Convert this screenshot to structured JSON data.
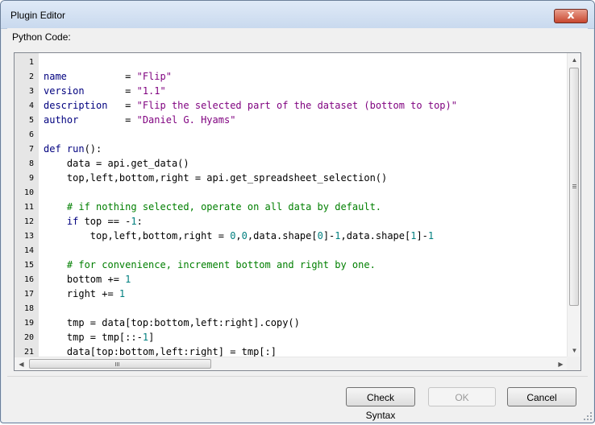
{
  "window": {
    "title": "Plugin Editor",
    "close_glyph": "x"
  },
  "editor": {
    "label": "Python Code:",
    "lines": [
      {
        "n": "1",
        "tokens": []
      },
      {
        "n": "2",
        "tokens": [
          {
            "t": "kw",
            "v": "name"
          },
          {
            "t": "op",
            "v": "          = "
          },
          {
            "t": "str",
            "v": "\"Flip\""
          }
        ]
      },
      {
        "n": "3",
        "tokens": [
          {
            "t": "kw",
            "v": "version"
          },
          {
            "t": "op",
            "v": "       = "
          },
          {
            "t": "str",
            "v": "\"1.1\""
          }
        ]
      },
      {
        "n": "4",
        "tokens": [
          {
            "t": "kw",
            "v": "description"
          },
          {
            "t": "op",
            "v": "   = "
          },
          {
            "t": "str",
            "v": "\"Flip the selected part of the dataset (bottom to top)\""
          }
        ]
      },
      {
        "n": "5",
        "tokens": [
          {
            "t": "kw",
            "v": "author"
          },
          {
            "t": "op",
            "v": "        = "
          },
          {
            "t": "str",
            "v": "\"Daniel G. Hyams\""
          }
        ]
      },
      {
        "n": "6",
        "tokens": []
      },
      {
        "n": "7",
        "tokens": [
          {
            "t": "kw",
            "v": "def run"
          },
          {
            "t": "op",
            "v": "():"
          }
        ]
      },
      {
        "n": "8",
        "tokens": [
          {
            "t": "op",
            "v": "    data = api.get_data()"
          }
        ]
      },
      {
        "n": "9",
        "tokens": [
          {
            "t": "op",
            "v": "    top,left,bottom,right = api.get_spreadsheet_selection()"
          }
        ]
      },
      {
        "n": "10",
        "tokens": []
      },
      {
        "n": "11",
        "tokens": [
          {
            "t": "cmt",
            "v": "    # if nothing selected, operate on all data by default."
          }
        ]
      },
      {
        "n": "12",
        "tokens": [
          {
            "t": "kw",
            "v": "    if"
          },
          {
            "t": "op",
            "v": " top == -"
          },
          {
            "t": "num",
            "v": "1"
          },
          {
            "t": "op",
            "v": ":"
          }
        ]
      },
      {
        "n": "13",
        "tokens": [
          {
            "t": "op",
            "v": "        top,left,bottom,right = "
          },
          {
            "t": "num",
            "v": "0"
          },
          {
            "t": "op",
            "v": ","
          },
          {
            "t": "num",
            "v": "0"
          },
          {
            "t": "op",
            "v": ",data.shape["
          },
          {
            "t": "num",
            "v": "0"
          },
          {
            "t": "op",
            "v": "]-"
          },
          {
            "t": "num",
            "v": "1"
          },
          {
            "t": "op",
            "v": ",data.shape["
          },
          {
            "t": "num",
            "v": "1"
          },
          {
            "t": "op",
            "v": "]-"
          },
          {
            "t": "num",
            "v": "1"
          }
        ]
      },
      {
        "n": "14",
        "tokens": []
      },
      {
        "n": "15",
        "tokens": [
          {
            "t": "cmt",
            "v": "    # for convenience, increment bottom and right by one."
          }
        ]
      },
      {
        "n": "16",
        "tokens": [
          {
            "t": "op",
            "v": "    bottom += "
          },
          {
            "t": "num",
            "v": "1"
          }
        ]
      },
      {
        "n": "17",
        "tokens": [
          {
            "t": "op",
            "v": "    right += "
          },
          {
            "t": "num",
            "v": "1"
          }
        ]
      },
      {
        "n": "18",
        "tokens": []
      },
      {
        "n": "19",
        "tokens": [
          {
            "t": "op",
            "v": "    tmp = data[top:bottom,left:right].copy()"
          }
        ]
      },
      {
        "n": "20",
        "tokens": [
          {
            "t": "op",
            "v": "    tmp = tmp[::-"
          },
          {
            "t": "num",
            "v": "1"
          },
          {
            "t": "op",
            "v": "]"
          }
        ]
      },
      {
        "n": "21",
        "tokens": [
          {
            "t": "op",
            "v": "    data[top:bottom,left:right] = tmp[:]"
          }
        ]
      }
    ]
  },
  "buttons": {
    "check_syntax": "Check Syntax",
    "ok": "OK",
    "cancel": "Cancel"
  },
  "icons": {
    "scroll_up": "▲",
    "scroll_down": "▼",
    "scroll_left": "◀",
    "scroll_right": "▶"
  }
}
